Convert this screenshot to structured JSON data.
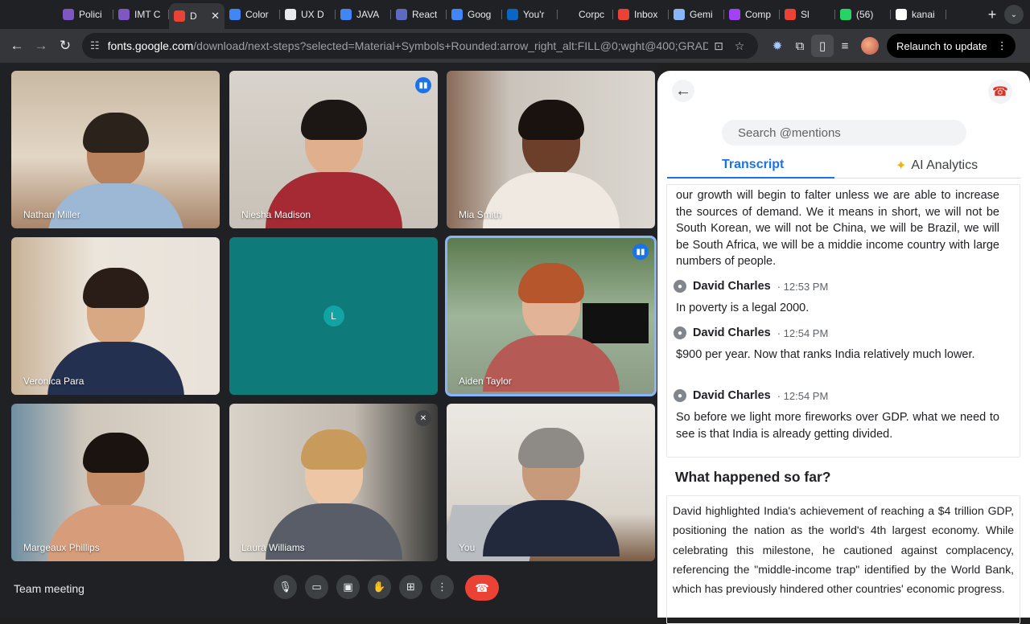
{
  "browser": {
    "tabs": [
      {
        "label": "Polici",
        "color": "#7e57c2"
      },
      {
        "label": "IMT C",
        "color": "#7e57c2"
      },
      {
        "label": "D",
        "color": "#ea4335",
        "active": true
      },
      {
        "label": "Color",
        "color": "#4285f4"
      },
      {
        "label": "UX D",
        "color": "#e8eaed"
      },
      {
        "label": "JAVA",
        "color": "#4285f4"
      },
      {
        "label": "React",
        "color": "#5c6bc0"
      },
      {
        "label": "Goog",
        "color": "#4285f4"
      },
      {
        "label": "You'r",
        "color": "#0a66c2"
      },
      {
        "label": "Corpc",
        "color": "#202124"
      },
      {
        "label": "Inbox",
        "color": "#ea4335"
      },
      {
        "label": "Gemi",
        "color": "#8ab4f8"
      },
      {
        "label": "Comp",
        "color": "#a142f4"
      },
      {
        "label": "Sl",
        "color": "#ea4335"
      },
      {
        "label": "(56)",
        "color": "#25d366"
      },
      {
        "label": "kanai",
        "color": "#ffffff"
      }
    ],
    "url_host": "fonts.google.com",
    "url_path": "/download/next-steps?selected=Material+Symbols+Rounded:arrow_right_alt:FILL@0;wght@400;GRAD@0...",
    "relaunch_label": "Relaunch to update"
  },
  "meeting": {
    "title": "Team meeting",
    "participants": [
      {
        "name": "Nathan Miller"
      },
      {
        "name": "Niesha Madison"
      },
      {
        "name": "Mia Smith"
      },
      {
        "name": "Veronica Para"
      },
      {
        "name": "",
        "initial": "L"
      },
      {
        "name": "Aiden Taylor"
      },
      {
        "name": "Margeaux Phillips"
      },
      {
        "name": "Laura Williams"
      },
      {
        "name": "You"
      }
    ]
  },
  "panel": {
    "search_placeholder": "Search @mentions",
    "tab_transcript": "Transcript",
    "tab_ai": "AI Analytics",
    "transcript_intro": "our growth will begin to falter unless we are able to increase the sources of demand. We it means in short, we will not be South Korean, we will not be China, we will be Brazil, we will be South Africa, we will be a middie income country with large numbers of people.",
    "entries": [
      {
        "speaker": "David Charles",
        "time": "· 12:53 PM",
        "text": "In poverty is a legal 2000."
      },
      {
        "speaker": "David Charles",
        "time": "· 12:54 PM",
        "text": "$900 per year. Now that ranks India relatively much lower."
      },
      {
        "speaker": "David Charles",
        "time": "· 12:54 PM",
        "text": "So before we light more fireworks over GDP. what we need to see is that India is already getting divided."
      }
    ],
    "summary_title": "What happened so far?",
    "summary_text": "David highlighted India's achievement of reaching a $4 trillion GDP, positioning the nation as the world's 4th largest economy. While celebrating this milestone, he cautioned against complacency, referencing the \"middle-income trap\" identified by the World Bank, which has previously hindered other countries' economic progress."
  }
}
